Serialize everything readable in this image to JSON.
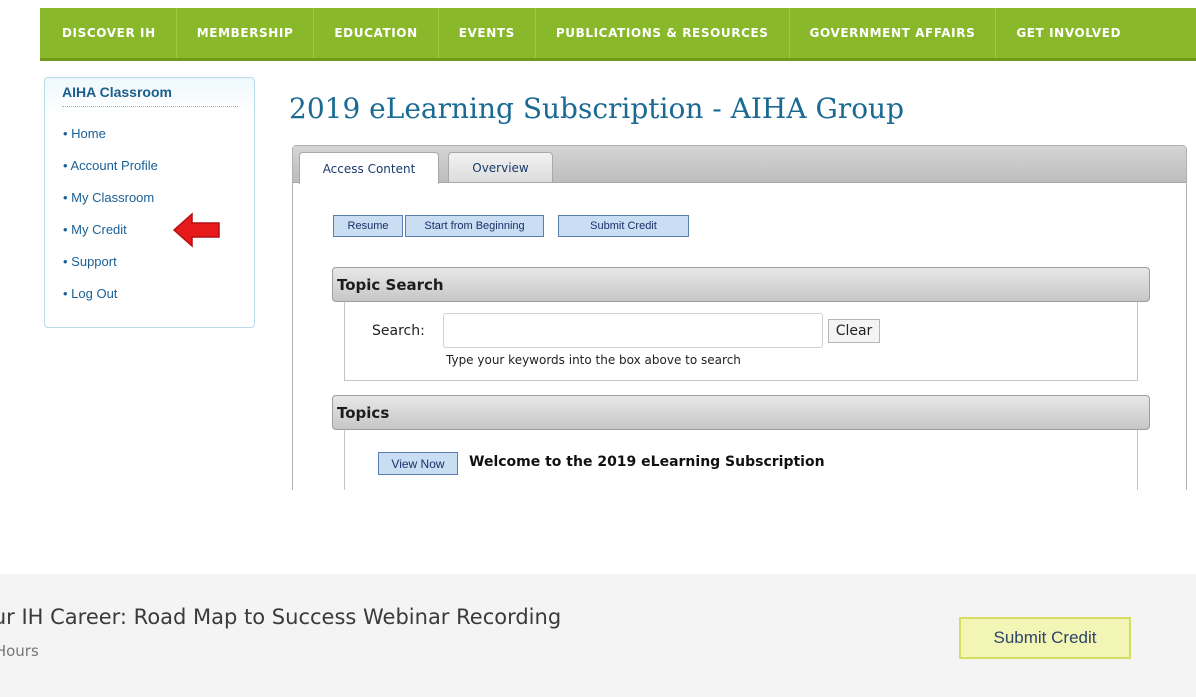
{
  "nav": {
    "items": [
      "DISCOVER IH",
      "MEMBERSHIP",
      "EDUCATION",
      "EVENTS",
      "PUBLICATIONS & RESOURCES",
      "GOVERNMENT AFFAIRS",
      "GET INVOLVED"
    ]
  },
  "sidebar": {
    "title": "AIHA Classroom",
    "items": [
      "• Home",
      "• Account Profile",
      "• My Classroom",
      "• My Credit",
      "• Support",
      "• Log Out"
    ]
  },
  "page": {
    "title": "2019 eLearning Subscription - AIHA Group"
  },
  "tabs": [
    "Access Content",
    "Overview"
  ],
  "actions": {
    "resume": "Resume",
    "start": "Start from Beginning",
    "submit_credit": "Submit Credit"
  },
  "topic_search": {
    "heading": "Topic Search",
    "label": "Search:",
    "value": "",
    "clear": "Clear",
    "hint": "Type your keywords into the box above to search"
  },
  "topics": {
    "heading": "Topics",
    "items": [
      {
        "button": "View Now",
        "title": "Welcome to the 2019 eLearning Subscription"
      }
    ]
  },
  "bottom": {
    "course_title": "our IH Career: Road Map to Success Webinar Recording",
    "hours": "it Hours",
    "submit": "Submit Credit"
  },
  "colors": {
    "nav_green": "#8ab82b",
    "title_blue": "#1a6a93",
    "arrow_red": "#e8191b",
    "submit_yellow": "#f3f5b5"
  }
}
